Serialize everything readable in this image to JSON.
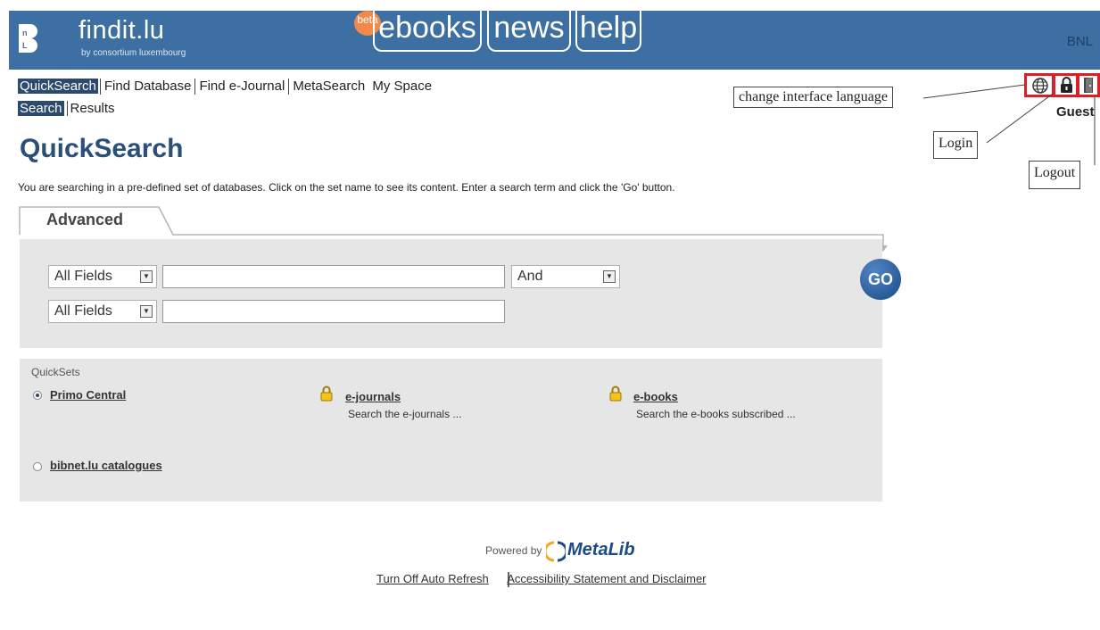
{
  "header": {
    "logo_text": "findit.lu",
    "logo_sub": "by consortium luxembourg",
    "badge": "beta",
    "pills": [
      "ebooks",
      "news",
      "help"
    ],
    "institution": "BNL"
  },
  "nav": {
    "items": [
      "QuickSearch",
      "Find Database",
      "Find e-Journal",
      "MetaSearch",
      "My Space"
    ],
    "sub_items": [
      "Search",
      "Results"
    ]
  },
  "icons": {
    "language": "globe-icon",
    "login": "lock-icon",
    "logout": "door-icon"
  },
  "callouts": {
    "language": "change interface language",
    "login": "Login",
    "logout": "Logout"
  },
  "user": "Guest",
  "page": {
    "title": "QuickSearch",
    "description": "You are searching in a pre-defined set of databases. Click on the set name to see its content. Enter a search term and click the 'Go' button.",
    "tab": "Advanced"
  },
  "search": {
    "field1": "All Fields",
    "field2": "All Fields",
    "operator": "And",
    "go": "GO"
  },
  "quicksets": {
    "title": "QuickSets",
    "items": [
      {
        "name": "Primo Central",
        "desc": ""
      },
      {
        "name": "e-journals",
        "desc": "Search the e-journals ..."
      },
      {
        "name": "e-books",
        "desc": "Search the e-books subscribed ..."
      },
      {
        "name": "bibnet.lu catalogues",
        "desc": ""
      }
    ]
  },
  "footer": {
    "powered_by": "Powered by",
    "brand": "MetaLib",
    "links": [
      "Turn Off Auto Refresh",
      "Accessibility Statement and Disclaimer"
    ]
  }
}
